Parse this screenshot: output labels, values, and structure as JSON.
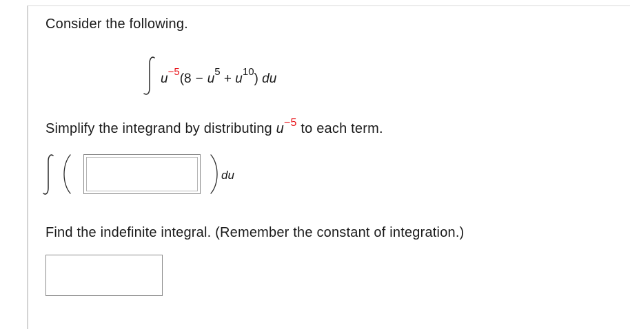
{
  "prompts": {
    "consider": "Consider the following.",
    "simplify_before": "Simplify the integrand by distributing ",
    "simplify_var": "u",
    "simplify_exp": "−5",
    "simplify_after": " to each term.",
    "find": "Find the indefinite integral. (Remember the constant of integration.)"
  },
  "expression": {
    "var1": "u",
    "exp1": "−5",
    "open": "(8",
    "minus": "−",
    "var2": "u",
    "exp2": "5",
    "plus": " + ",
    "var3": "u",
    "exp3": "10",
    "close": ")",
    "diff": "du"
  },
  "answer_row": {
    "du": "du",
    "input1_value": ""
  },
  "final_answer": {
    "input2_value": ""
  },
  "colors": {
    "accent_red": "#e8141a",
    "text": "#1a1a1a",
    "box_border": "#8a8a8a"
  }
}
